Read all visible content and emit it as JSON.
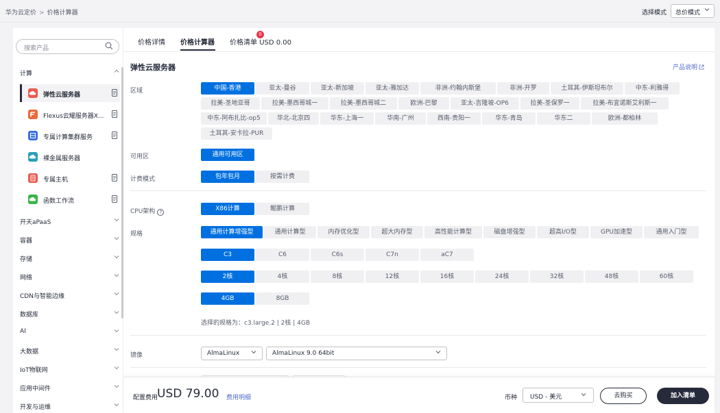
{
  "breadcrumb": {
    "root": "华为云定价",
    "separator": ">",
    "current": "价格计算器"
  },
  "mode": {
    "label": "选择模式",
    "value": "总价模式"
  },
  "sidebar": {
    "search_placeholder": "搜索产品",
    "compute_label": "计算",
    "services": [
      {
        "label": "弹性云服务器",
        "icon_color": "#ea5a4e",
        "icon": "cloud-icon",
        "active": true
      },
      {
        "label": "Flexus云耀服务器X...",
        "icon_color": "#ea6a3a",
        "icon": "flexus-icon"
      },
      {
        "label": "专属计算集群服务",
        "icon_color": "#3a6fd9",
        "icon": "cluster-icon"
      },
      {
        "label": "裸金属服务器",
        "icon_color": "#29a0b6",
        "icon": "cloud-icon"
      },
      {
        "label": "专属主机",
        "icon_color": "#ea5a4e",
        "icon": "host-icon"
      },
      {
        "label": "函数工作流",
        "icon_color": "#39b54a",
        "icon": "cloud-icon"
      }
    ],
    "categories": [
      "开天aPaaS",
      "容器",
      "存储",
      "网络",
      "CDN与智能边缘",
      "数据库",
      "AI",
      "大数据",
      "IoT物联网",
      "应用中间件",
      "开发与运维"
    ]
  },
  "tabs": {
    "details": "价格详情",
    "calculator": "价格计算器",
    "list": "价格清单",
    "badge": "0",
    "amount": "USD 0.00"
  },
  "product": {
    "title": "弹性云服务器",
    "help_link": "产品说明"
  },
  "region": {
    "label": "区域",
    "row1": [
      "中国-香港",
      "亚太-曼谷",
      "亚太-新加坡",
      "亚太-雅加达",
      "非洲-约翰内斯堡",
      "非洲-开罗",
      "土耳其-伊斯坦布尔",
      "中东-利雅得"
    ],
    "row2": [
      "拉美-圣地亚哥",
      "拉美-墨西哥城一",
      "拉美-墨西哥城二",
      "欧洲-巴黎",
      "亚太-吉隆坡-OP6",
      "拉美-圣保罗一",
      "拉美-布宜诺斯艾利斯一"
    ],
    "row3": [
      "中东-阿布扎比-op5",
      "华北-北京四",
      "华东-上海一",
      "华南-广州",
      "西南-贵阳一",
      "华东-青岛",
      "华东二",
      "欧洲-都柏林"
    ],
    "row4": [
      "土耳其-安卡拉-PUR"
    ]
  },
  "az": {
    "label": "可用区",
    "options": [
      "通用可用区"
    ]
  },
  "billing": {
    "label": "计费模式",
    "options": [
      "包年包月",
      "按需计费"
    ]
  },
  "cpu": {
    "label": "CPU架构",
    "help": "?",
    "options": [
      "X86计算",
      "鲲鹏计算"
    ]
  },
  "spec": {
    "label": "规格",
    "types": [
      "通用计算增强型",
      "通用计算型",
      "内存优化型",
      "超大内存型",
      "高性能计算型",
      "磁盘增强型",
      "超高I/O型",
      "GPU加速型",
      "通用入门型"
    ],
    "families": [
      "C3",
      "C6",
      "C6s",
      "C7n",
      "aC7"
    ],
    "cores": [
      "2核",
      "4核",
      "8核",
      "12核",
      "16核",
      "24核",
      "32核",
      "48核",
      "60核"
    ],
    "memory": [
      "4GB",
      "8GB"
    ],
    "selected_text": "选择的规格为：c3.large.2 | 2核 | 4GB"
  },
  "image": {
    "label": "镜像",
    "os": "AlmaLinux",
    "version": "AlmaLinux 9.0 64bit"
  },
  "footer": {
    "fee_label": "配置费用",
    "fee_amount": "USD 79.00",
    "fee_detail": "费用明细",
    "currency_label": "币种",
    "currency_value": "USD - 美元",
    "buy": "去购买",
    "add": "加入清单"
  },
  "colors": {
    "primary": "#0070e0",
    "dark": "#252b3a",
    "link": "#526ecc",
    "badge": "#e8344d"
  }
}
